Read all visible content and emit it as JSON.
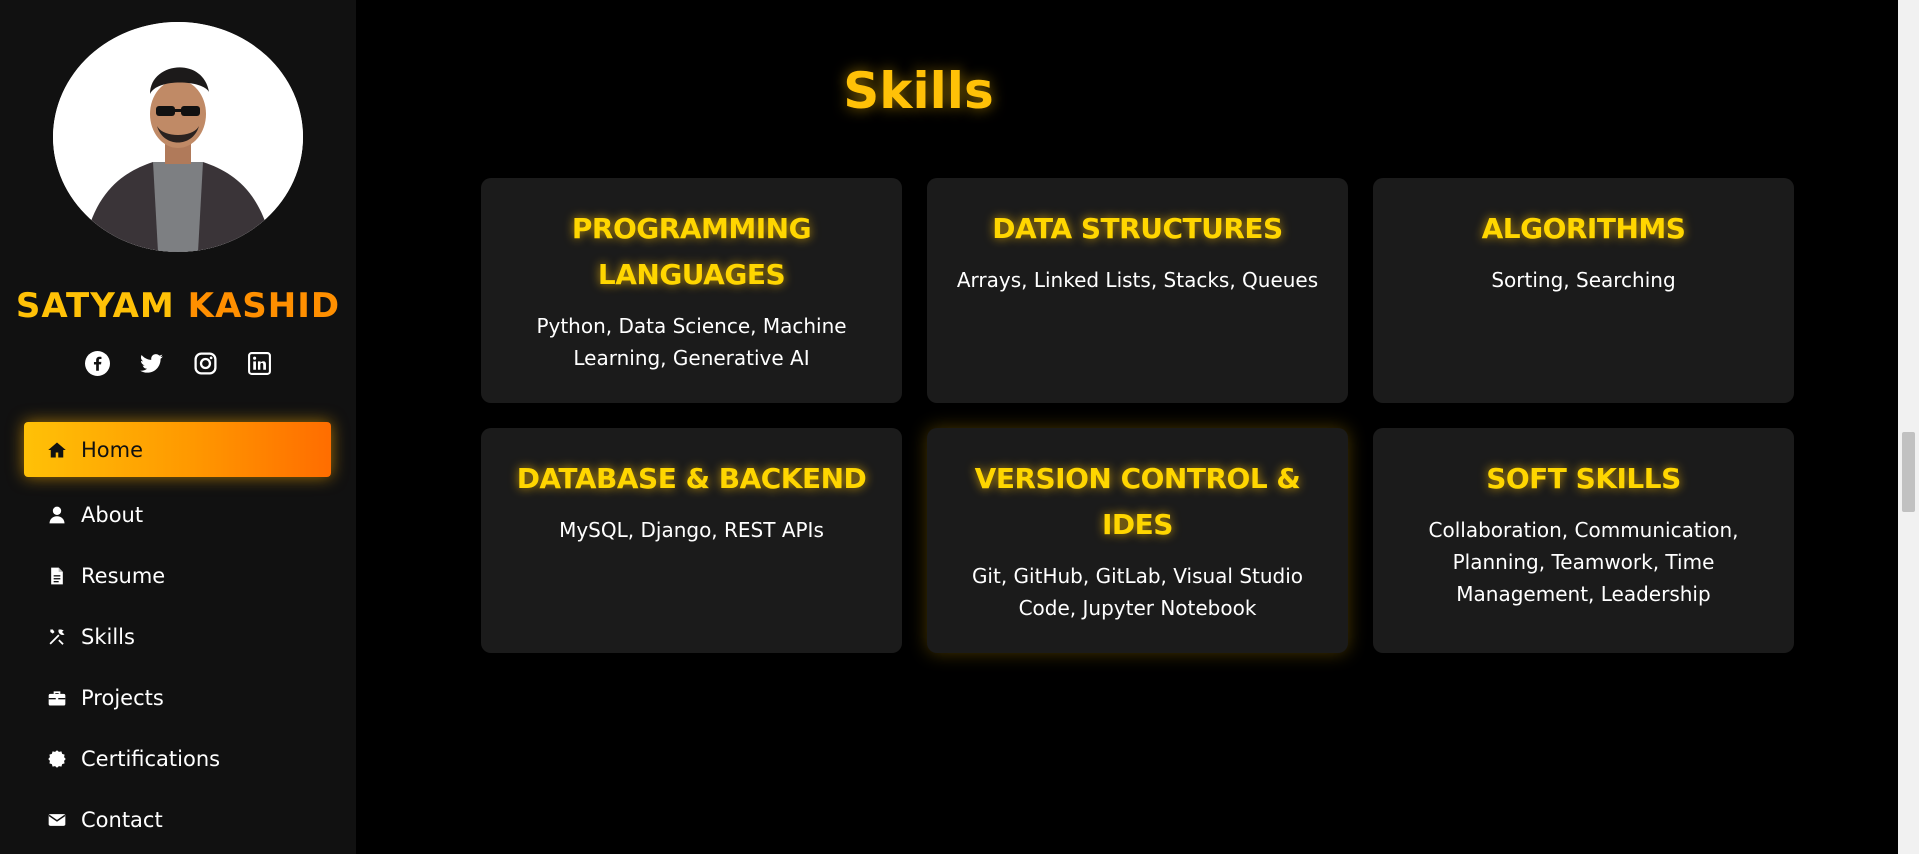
{
  "sidebar": {
    "name_first": "SATYAM",
    "name_last": "KASHID",
    "socials": [
      {
        "icon": "facebook-icon"
      },
      {
        "icon": "twitter-icon"
      },
      {
        "icon": "instagram-icon"
      },
      {
        "icon": "linkedin-icon"
      }
    ],
    "nav": [
      {
        "label": "Home",
        "icon": "home-icon",
        "active": true
      },
      {
        "label": "About",
        "icon": "user-icon"
      },
      {
        "label": "Resume",
        "icon": "file-icon"
      },
      {
        "label": "Skills",
        "icon": "tools-icon"
      },
      {
        "label": "Projects",
        "icon": "briefcase-icon"
      },
      {
        "label": "Certifications",
        "icon": "certificate-icon"
      },
      {
        "label": "Contact",
        "icon": "envelope-icon"
      }
    ]
  },
  "main": {
    "title": "Skills",
    "cards": [
      {
        "title": "PROGRAMMING LANGUAGES",
        "text": "Python, Data Science, Machine Learning, Generative AI"
      },
      {
        "title": "DATA STRUCTURES",
        "text": "Arrays, Linked Lists, Stacks, Queues"
      },
      {
        "title": "ALGORITHMS",
        "text": "Sorting, Searching"
      },
      {
        "title": "DATABASE & BACKEND",
        "text": "MySQL, Django, REST APIs"
      },
      {
        "title": "VERSION CONTROL & IDES",
        "text": "Git, GitHub, GitLab, Visual Studio Code, Jupyter Notebook"
      },
      {
        "title": "SOFT SKILLS",
        "text": "Collaboration, Communication, Planning, Teamwork, Time Management, Leadership"
      }
    ]
  },
  "colors": {
    "accent": "#ffc107",
    "accent_orange": "#ff8f00",
    "sidebar_bg": "#111111",
    "card_bg": "#1b1b1b",
    "page_bg": "#000000"
  }
}
